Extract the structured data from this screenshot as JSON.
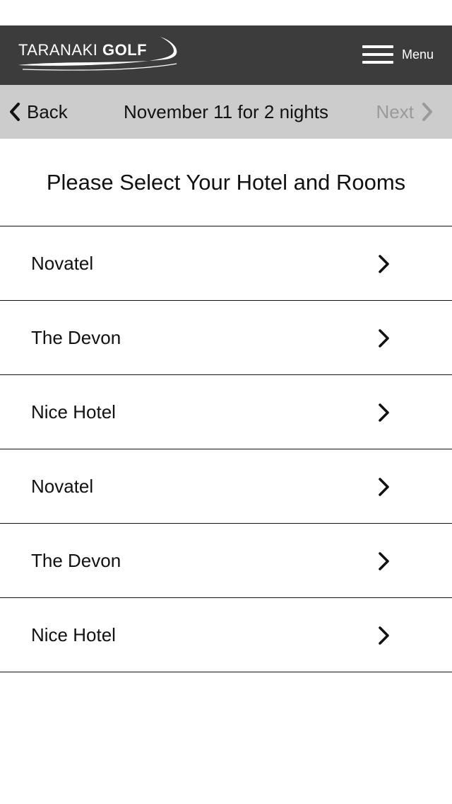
{
  "header": {
    "logo": {
      "text_light": "TARANAKI",
      "text_bold": "GOLF"
    },
    "menu": {
      "label": "Menu",
      "icon": "hamburger-icon"
    }
  },
  "nav": {
    "back_label": "Back",
    "title": "November 11 for 2 nights",
    "next_label": "Next",
    "next_enabled": false
  },
  "page": {
    "heading": "Please Select Your Hotel and Rooms"
  },
  "hotels": [
    {
      "name": "Novatel"
    },
    {
      "name": "The Devon"
    },
    {
      "name": "Nice Hotel"
    },
    {
      "name": "Novatel"
    },
    {
      "name": "The Devon"
    },
    {
      "name": "Nice Hotel"
    }
  ],
  "colors": {
    "header_bg": "#3c3c3c",
    "navbar_bg": "#cccccc",
    "disabled_text": "#9a9a9a"
  }
}
